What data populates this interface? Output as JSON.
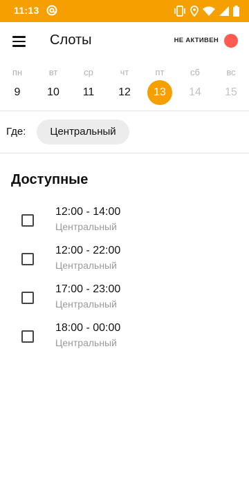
{
  "status_bar": {
    "time": "11:13",
    "icons": [
      "at-sign-icon",
      "vibrate-icon",
      "location-icon",
      "wifi-icon",
      "signal-icon",
      "battery-icon"
    ]
  },
  "header": {
    "title": "Слоты",
    "status_label": "НЕ АКТИВЕН",
    "status_color": "#ff5b52"
  },
  "calendar": {
    "days": [
      {
        "name": "пн",
        "number": "9"
      },
      {
        "name": "вт",
        "number": "10"
      },
      {
        "name": "ср",
        "number": "11"
      },
      {
        "name": "чт",
        "number": "12"
      },
      {
        "name": "пт",
        "number": "13"
      },
      {
        "name": "сб",
        "number": "14"
      },
      {
        "name": "вс",
        "number": "15"
      }
    ],
    "selected_index": 4,
    "accent_color": "#f59f00"
  },
  "filter": {
    "where_label": "Где:",
    "location": "Центральный"
  },
  "available": {
    "title": "Доступные",
    "slots": [
      {
        "time": "12:00 - 14:00",
        "place": "Центральный"
      },
      {
        "time": "12:00 - 22:00",
        "place": "Центральный"
      },
      {
        "time": "17:00 - 23:00",
        "place": "Центральный"
      },
      {
        "time": "18:00 - 00:00",
        "place": "Центральный"
      }
    ]
  }
}
